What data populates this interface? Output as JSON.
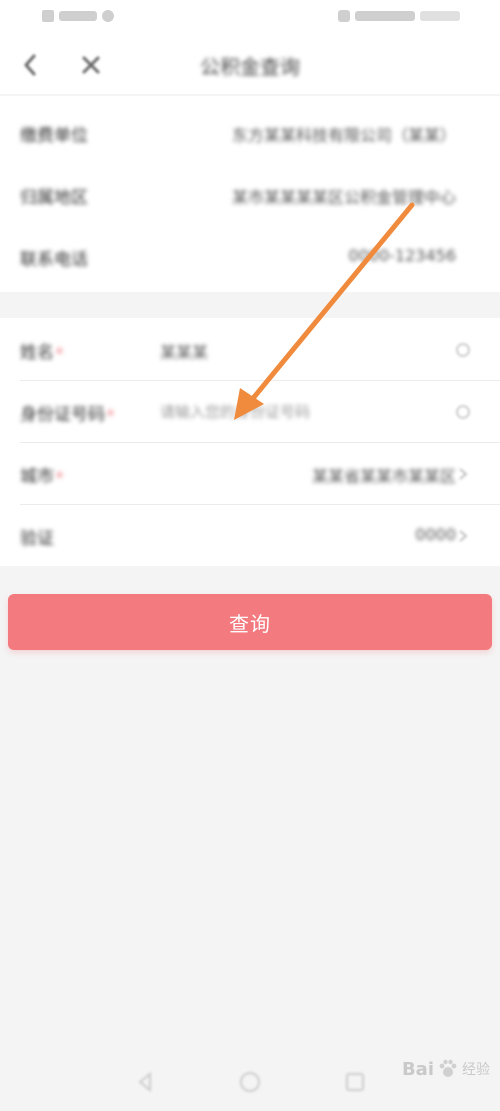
{
  "header": {
    "title": "公积金查询",
    "back_icon": "back-arrow-icon",
    "close_icon": "close-icon"
  },
  "info_rows": [
    {
      "label": "缴费单位",
      "value": "东方某某科技有限公司（某某）"
    },
    {
      "label": "归属地区",
      "value": "某市某某某某区公积金管理中心"
    },
    {
      "label": "联系电话",
      "value": "0000-123456"
    }
  ],
  "form_rows": [
    {
      "label": "姓名",
      "required": true,
      "value": "某某某"
    },
    {
      "label": "身份证号码",
      "required": true,
      "value": "请输入您的身份证号码"
    },
    {
      "label": "城市",
      "required": true,
      "value": "某某省某某市某某区"
    },
    {
      "label": "验证",
      "required": false,
      "value": "0000"
    }
  ],
  "query_button": {
    "label": "查询"
  },
  "watermark": {
    "logo": "Bai",
    "suffix": "经验"
  },
  "colors": {
    "accent": "#f37a7f",
    "annotation_arrow": "#f08a3c",
    "required_mark": "#e8505b"
  }
}
